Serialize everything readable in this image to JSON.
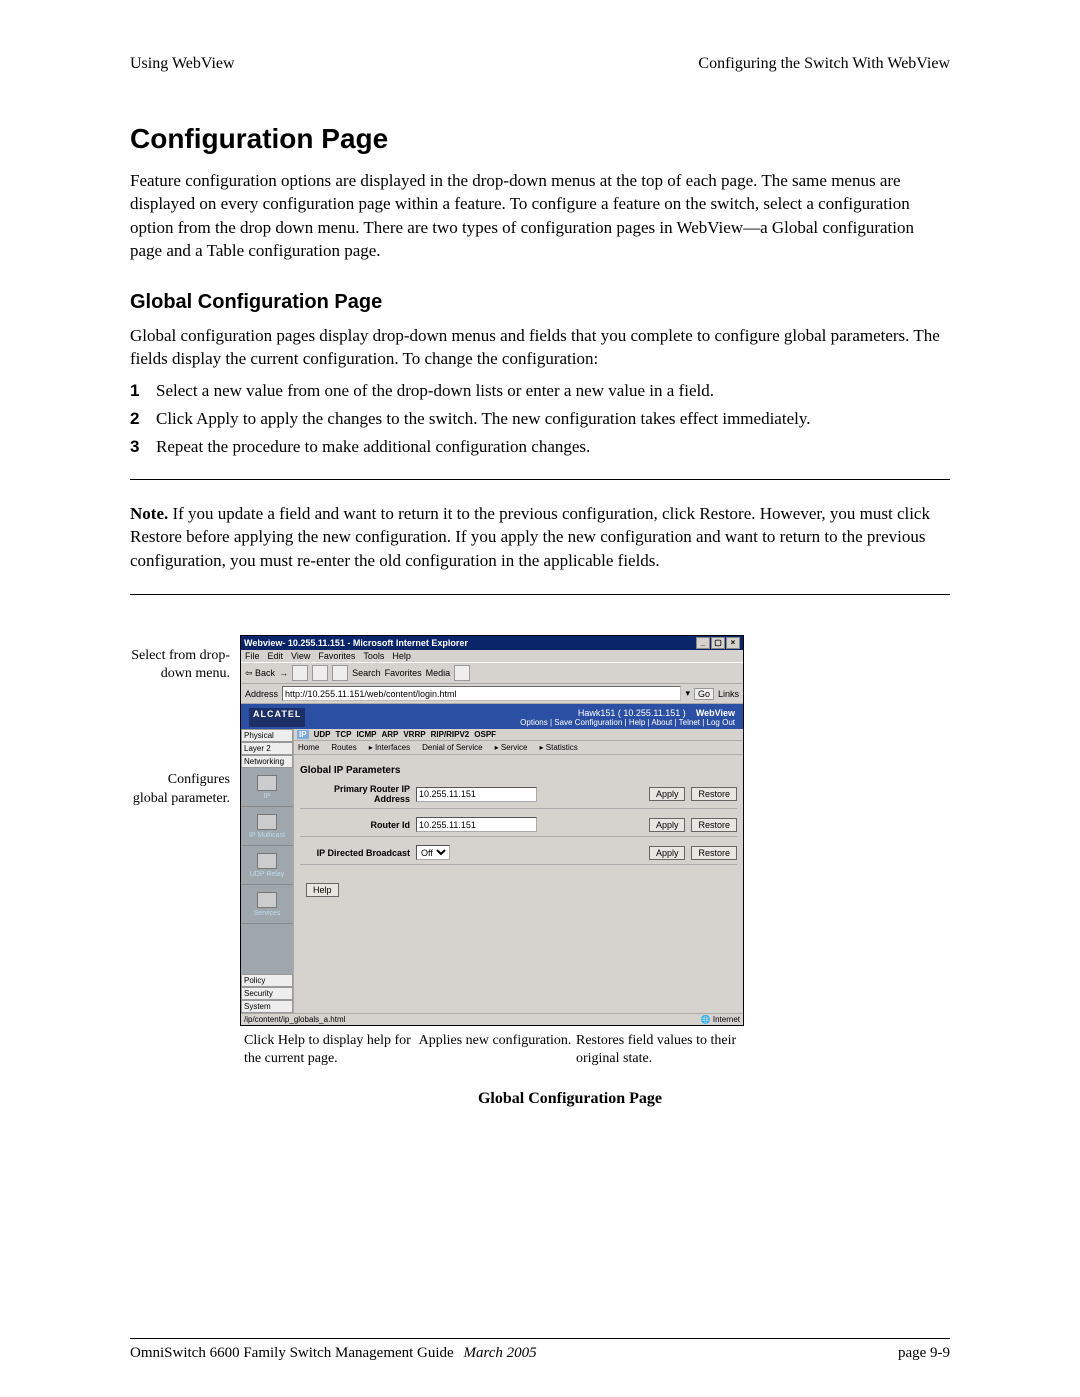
{
  "runhead": {
    "left": "Using WebView",
    "right": "Configuring the Switch With WebView"
  },
  "h1": "Configuration Page",
  "p1": "Feature configuration options are displayed in the drop-down menus at the top of each page. The same menus are displayed on every configuration page within a feature. To configure a feature on the switch, select a configuration option from the drop down menu. There are two types of configuration pages in WebView—a Global configuration page and a Table configuration page.",
  "h2": "Global Configuration Page",
  "p2": "Global configuration pages display drop-down menus and fields that you complete to configure global parameters. The fields display the current configuration. To change the configuration:",
  "steps": [
    "Select a new value from one of the drop-down lists or enter a new value in a field.",
    "Click Apply to apply the changes to the switch. The new configuration takes effect immediately.",
    "Repeat the procedure to make additional configuration changes."
  ],
  "note_label": "Note.",
  "note_body": " If you update a field and want to return it to the previous configuration, click Restore. However, you must click Restore before applying the new configuration. If you apply the new configuration and want to return to the previous configuration, you must re-enter the old configuration in the applicable fields.",
  "annot": {
    "a1": "Select from drop-down menu.",
    "a2": "Configures global parameter."
  },
  "browser": {
    "title": "Webview- 10.255.11.151 - Microsoft Internet Explorer",
    "menu": [
      "File",
      "Edit",
      "View",
      "Favorites",
      "Tools",
      "Help"
    ],
    "toolbar": {
      "back": "Back",
      "search": "Search",
      "favorites": "Favorites",
      "media": "Media"
    },
    "addr_label": "Address",
    "addr_value": "http://10.255.11.151/web/content/login.html",
    "go": "Go",
    "links": "Links",
    "banner": {
      "brand": "ALCATEL",
      "hawk": "Hawk151 ( 10.255.11.151 )",
      "product": "WebView",
      "opts": "Options | Save Configuration | Help | About | Telnet | Log Out"
    },
    "ltabs": [
      "Physical",
      "Layer 2",
      "Networking"
    ],
    "licons": [
      "IP",
      "IP Multicast",
      "UDP Relay",
      "Services"
    ],
    "lbottom": [
      "Policy",
      "Security",
      "System"
    ],
    "ribbon": [
      "IP",
      "UDP",
      "TCP",
      "ICMP",
      "ARP",
      "VRRP",
      "RIP/RIPV2",
      "OSPF"
    ],
    "crumb": [
      "Home",
      "Routes",
      "Interfaces",
      "Denial of Service",
      "Service",
      "Statistics"
    ],
    "heading": "Global IP Parameters",
    "rows": [
      {
        "label": "Primary Router IP Address",
        "value": "10.255.11.151",
        "type": "text"
      },
      {
        "label": "Router Id",
        "value": "10.255.11.151",
        "type": "text"
      },
      {
        "label": "IP Directed Broadcast",
        "value": "Off",
        "type": "select"
      }
    ],
    "apply": "Apply",
    "restore": "Restore",
    "help": "Help",
    "status_left": "/ip/content/ip_globals_a.html",
    "status_right": "Internet"
  },
  "caps": {
    "c1": "Click Help to display help for the current page.",
    "c2": "Applies new configuration.",
    "c3": "Restores field values to their original state."
  },
  "figtitle": "Global Configuration Page",
  "footer": {
    "left": "OmniSwitch 6600 Family Switch Management Guide",
    "date": "March 2005",
    "right": "page 9-9"
  }
}
